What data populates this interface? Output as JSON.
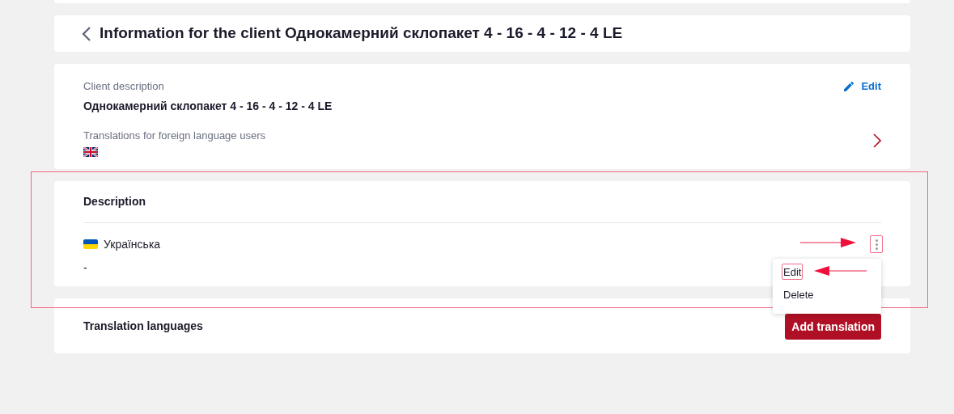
{
  "header": {
    "title": "Information for the client Однокамерний склопакет 4 - 16 - 4 - 12 - 4 LE"
  },
  "client_info": {
    "description_label": "Client description",
    "description": "Однокамерний склопакет 4 - 16 - 4 - 12 - 4 LE",
    "edit_label": "Edit",
    "translations_label": "Translations for foreign language users"
  },
  "description_section": {
    "title": "Description",
    "entries": [
      {
        "language": "Українська",
        "text": "-"
      }
    ]
  },
  "row_menu": {
    "items": [
      "Edit",
      "Delete"
    ]
  },
  "translation_languages": {
    "title": "Translation languages",
    "add_button": "Add translation"
  }
}
